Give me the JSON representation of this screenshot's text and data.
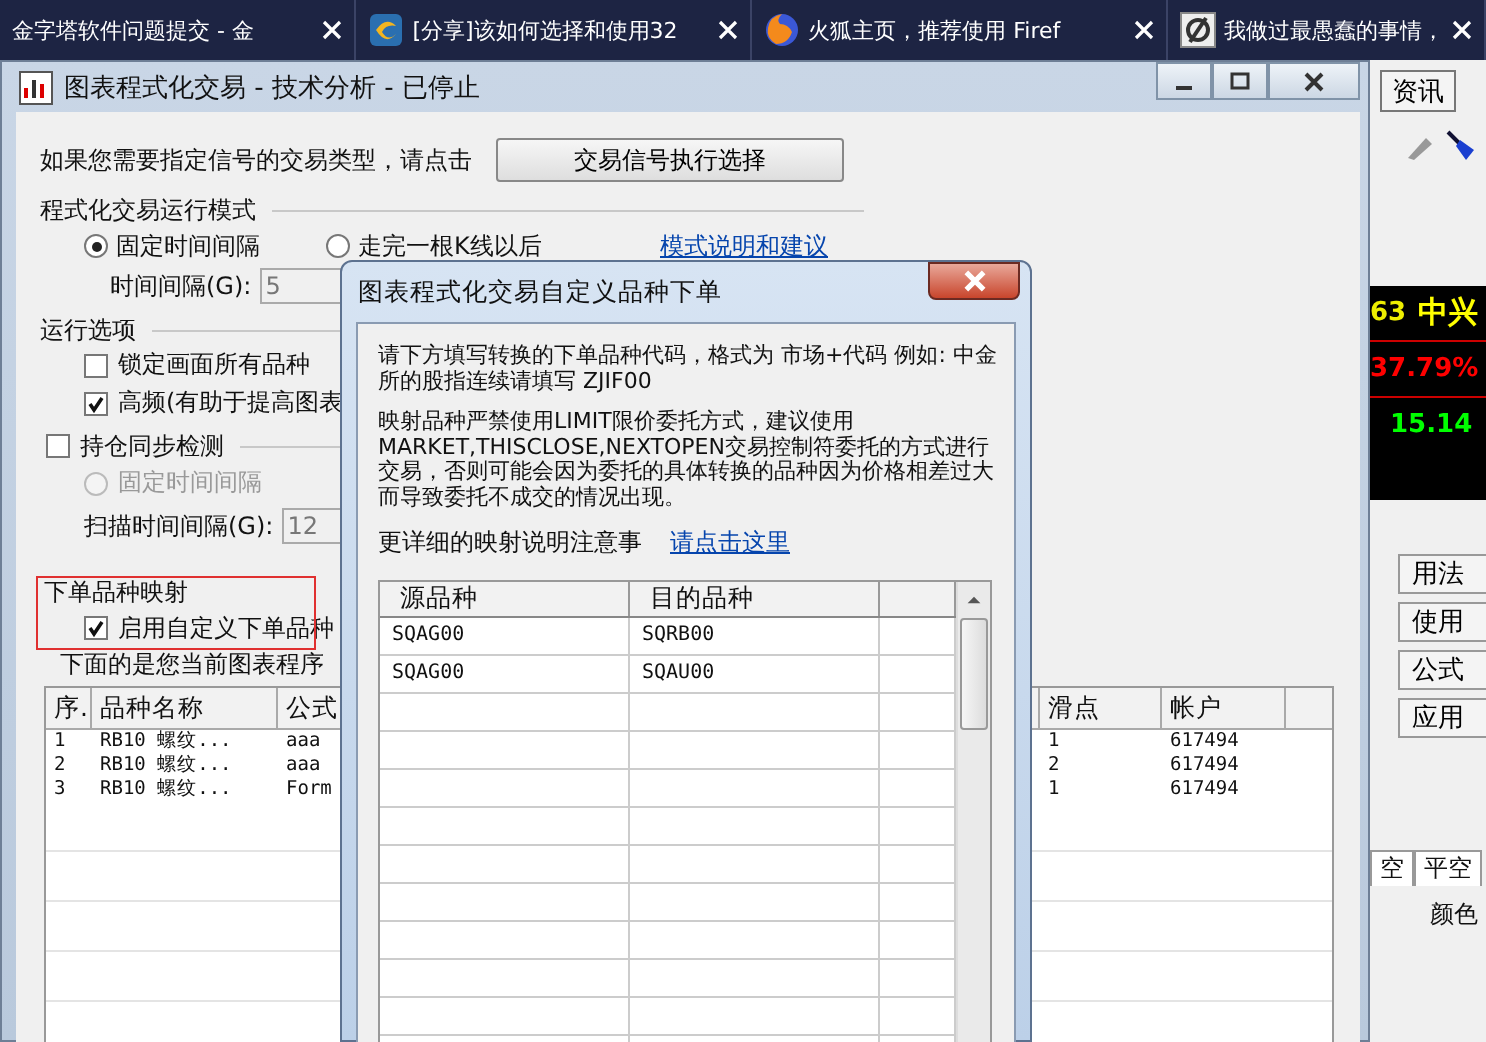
{
  "browser_tabs": [
    {
      "kind": "plain",
      "title": "金字塔软件问题提交 - 金"
    },
    {
      "kind": "swirl",
      "title": "[分享]该如何选择和使用32"
    },
    {
      "kind": "fox",
      "title": "火狐主页，推荐使用 Firef"
    },
    {
      "kind": "null",
      "title": "我做过最愚蠢的事情，"
    }
  ],
  "main_window": {
    "title": "图表程式化交易 - 技术分析 - 已停止",
    "signal_prompt": "如果您需要指定信号的交易类型，请点击",
    "signal_button": "交易信号执行选择",
    "run_mode": {
      "label": "程式化交易运行模式",
      "options": [
        {
          "label": "固定时间间隔",
          "selected": true
        },
        {
          "label": "走完一根K线以后",
          "selected": false
        }
      ],
      "help_link": "模式说明和建议",
      "interval_label": "时间间隔(G):",
      "interval_value": "5"
    },
    "run_options": {
      "label": "运行选项",
      "checkboxes": [
        {
          "label": "锁定画面所有品种",
          "checked": false
        },
        {
          "label": "高频(有助于提高图表",
          "checked": true
        }
      ]
    },
    "position_sync": {
      "label": "持仓同步检测",
      "checked": false,
      "mode": {
        "label": "固定时间间隔",
        "selected": false,
        "disabled": true
      },
      "scan_label": "扫描时间间隔(G):",
      "scan_value": "12"
    },
    "mapping": {
      "label": "下单品种映射",
      "enable": {
        "label": "启用自定义下单品种",
        "checked": true
      },
      "note": "下面的是您当前图表程序"
    },
    "table": {
      "columns": [
        "序.",
        "品种名称",
        "公式",
        "滑点",
        "帐户"
      ],
      "rows": [
        [
          "1",
          "RB10 螺纹...",
          "aaa",
          "1",
          "617494"
        ],
        [
          "2",
          "RB10 螺纹...",
          "aaa",
          "2",
          "617494"
        ],
        [
          "3",
          "RB10 螺纹...",
          "Form",
          "1",
          "617494"
        ]
      ]
    }
  },
  "dialog": {
    "title": "图表程式化交易自定义品种下单",
    "instructions": [
      "请下方填写转换的下单品种代码，格式为 市场+代码 例如: 中金所的股指连续请填写 ZJIF00",
      "映射品种严禁使用LIMIT限价委托方式，建议使用MARKET,THISCLOSE,NEXTOPEN交易控制符委托的方式进行交易，否则可能会因为委托的具体转换的品种因为价格相差过大而导致委托不成交的情况出现。"
    ],
    "detail_label": "更详细的映射说明注意事",
    "detail_link": "请点击这里",
    "table": {
      "columns": [
        "源品种",
        "目的品种"
      ],
      "rows": [
        [
          "SQAG00",
          "SQRB00"
        ],
        [
          "SQAG00",
          "SQAU00"
        ]
      ]
    }
  },
  "background_app": {
    "top_button": "资讯",
    "quote": {
      "code": "63",
      "name": "中兴",
      "change": "37.79%",
      "price": "15.14"
    },
    "side_buttons": [
      "用法",
      "使用",
      "公式",
      "应用"
    ],
    "tabs": [
      "空",
      "平空"
    ],
    "color_label": "颜色"
  }
}
